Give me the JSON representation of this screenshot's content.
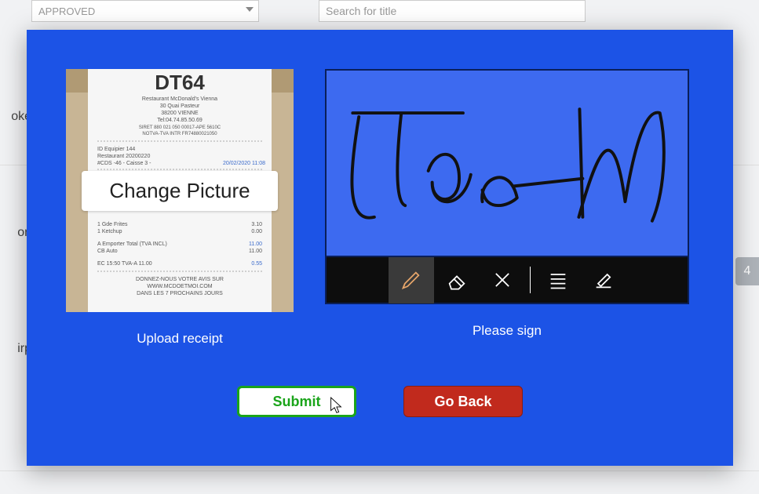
{
  "background": {
    "status_select": "APPROVED",
    "search_placeholder": "Search for title",
    "left_fragments": [
      "oke",
      "on",
      "irp"
    ],
    "right_badge": "4"
  },
  "modal": {
    "receipt": {
      "header": "DT64",
      "change_button": "Change Picture",
      "caption": "Upload receipt"
    },
    "signature": {
      "caption": "Please sign",
      "tools": {
        "pen": "pen-icon",
        "eraser": "eraser-icon",
        "clear": "clear-icon",
        "lines": "lines-icon",
        "edit": "edit-icon"
      }
    },
    "buttons": {
      "submit": "Submit",
      "go_back": "Go Back"
    }
  }
}
